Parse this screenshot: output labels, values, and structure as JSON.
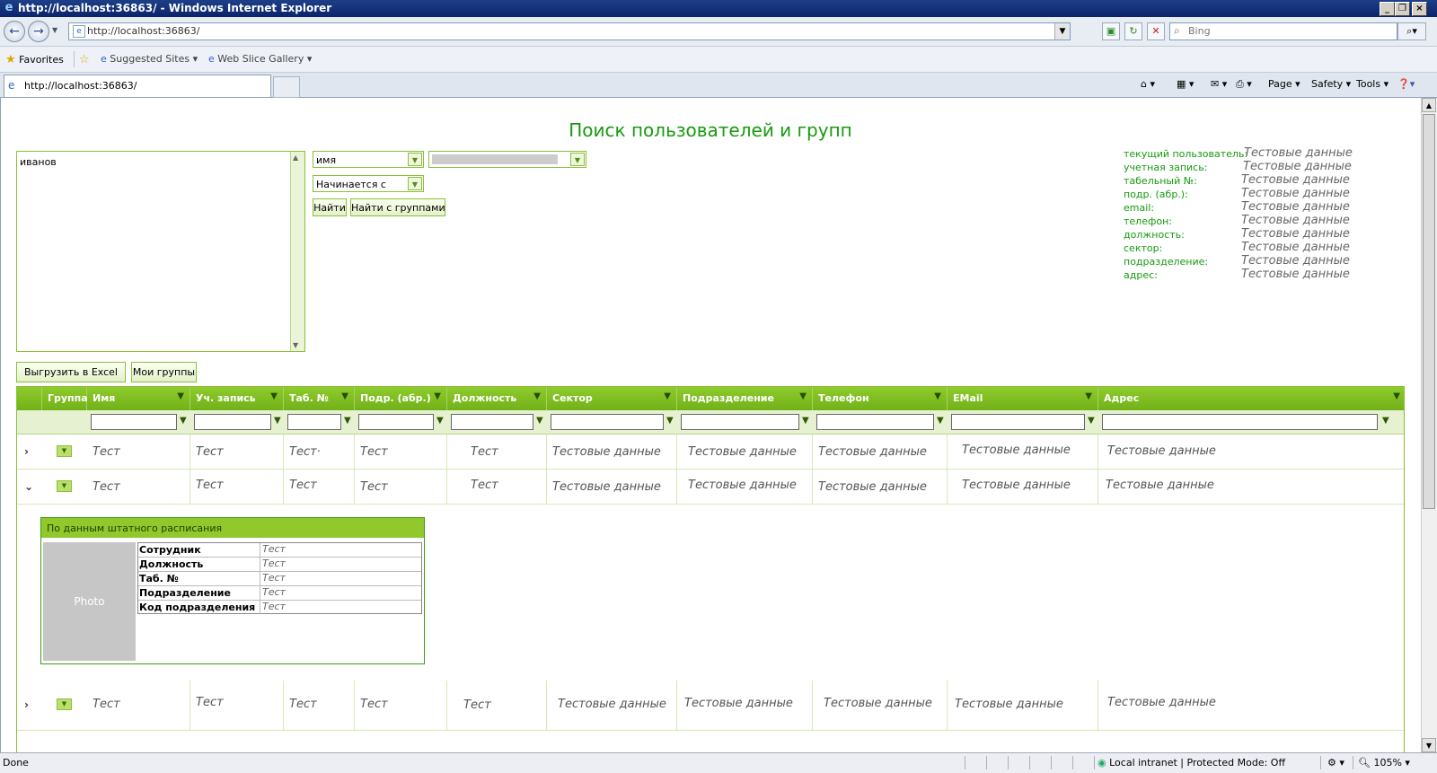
{
  "window": {
    "title": "http://localhost:36863/ - Windows Internet Explorer"
  },
  "browser": {
    "address": "http://localhost:36863/",
    "search_placeholder": "Bing",
    "favorites_label": "Favorites",
    "suggested_sites": "Suggested Sites",
    "web_slice_gallery": "Web Slice Gallery",
    "tab_title": "http://localhost:36863/",
    "cmd_page": "Page",
    "cmd_safety": "Safety",
    "cmd_tools": "Tools"
  },
  "status": {
    "text": "Done",
    "zone": "Local intranet | Protected Mode: Off",
    "zoom": "105%"
  },
  "page": {
    "title": "Поиск пользователей и групп",
    "search_text": "иванов",
    "field_select": "имя",
    "mode_select": "Начинается с",
    "find_button": "Найти",
    "find_groups_button": "Найти с группами",
    "export_button": "Выгрузить в Excel",
    "my_groups_button": "Мои группы"
  },
  "user_info": [
    {
      "label": "текущий пользователь:",
      "value": "Тестовые данные"
    },
    {
      "label": "учетная запись:",
      "value": "Тестовые данные"
    },
    {
      "label": "табельный №:",
      "value": "Тестовые данные"
    },
    {
      "label": "подр. (абр.):",
      "value": "Тестовые данные"
    },
    {
      "label": "email:",
      "value": "Тестовые данные"
    },
    {
      "label": "телефон:",
      "value": "Тестовые данные"
    },
    {
      "label": "должность:",
      "value": "Тестовые данные"
    },
    {
      "label": "сектор:",
      "value": "Тестовые данные"
    },
    {
      "label": "подразделение:",
      "value": "Тестовые данные"
    },
    {
      "label": "адрес:",
      "value": "Тестовые данные"
    }
  ],
  "grid": {
    "columns": [
      "Группа",
      "Имя",
      "Уч. запись",
      "Таб. №",
      "Подр. (абр.)",
      "Должность",
      "Сектор",
      "Подразделение",
      "Телефон",
      "EMail",
      "Адрес"
    ],
    "rows": [
      {
        "expand": "›",
        "cells": [
          "Тест",
          "Тест",
          "Тест·",
          "Тест",
          "Тест",
          "Тестовые данные",
          "Тестовые данные",
          "Тестовые данные",
          "Тестовые данные",
          "Тестовые данные"
        ]
      },
      {
        "expand": "⌄",
        "cells": [
          "Тест",
          "Тест",
          "Тест",
          "Тест",
          "Тест",
          "Тестовые данные",
          "Тестовые данные",
          "Тестовые данные",
          "Тестовые данные",
          "Тестовые данные"
        ]
      },
      {
        "expand": "›",
        "cells": [
          "Тест",
          "Тест",
          "Тест",
          "Тест",
          "Тест",
          "Тестовые данные",
          "Тестовые данные",
          "Тестовые данные",
          "Тестовые данные",
          "Тестовые данные"
        ]
      }
    ]
  },
  "detail": {
    "header": "По данным штатного расписания",
    "photo": "Photo",
    "rows": [
      {
        "label": "Сотрудник",
        "value": "Тест"
      },
      {
        "label": "Должность",
        "value": "Тест"
      },
      {
        "label": "Таб. №",
        "value": "Тест"
      },
      {
        "label": "Подразделение",
        "value": "Тест"
      },
      {
        "label": "Код подразделения",
        "value": "Тест"
      }
    ]
  },
  "colors": {
    "accent": "#179a0f",
    "grid_header": "#7fbe24",
    "border": "#8cbf3a"
  }
}
